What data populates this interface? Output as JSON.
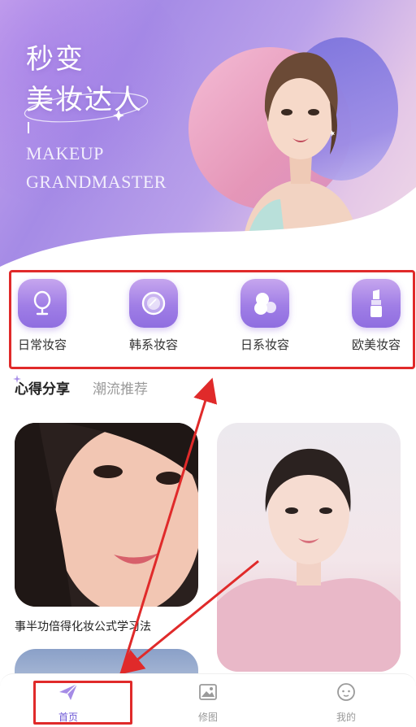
{
  "banner": {
    "title_line1": "秒变",
    "title_line2": "美妆达人",
    "subtitle_line1": "MAKEUP",
    "subtitle_line2": "GRANDMASTER"
  },
  "categories": [
    {
      "label": "日常妆容",
      "icon": "mirror-icon"
    },
    {
      "label": "韩系妆容",
      "icon": "compact-icon"
    },
    {
      "label": "日系妆容",
      "icon": "puff-icon"
    },
    {
      "label": "欧美妆容",
      "icon": "lipstick-icon"
    }
  ],
  "tabs": {
    "active": "心得分享",
    "inactive": "潮流推荐"
  },
  "cards": [
    {
      "caption": "事半功倍得化妆公式学习法"
    }
  ],
  "bottom_nav": {
    "home": "首页",
    "edit": "修图",
    "mine": "我的"
  },
  "colors": {
    "accent": "#8f6ee0",
    "nav_active": "#6f5ad6",
    "annotation": "#e02a2a"
  }
}
